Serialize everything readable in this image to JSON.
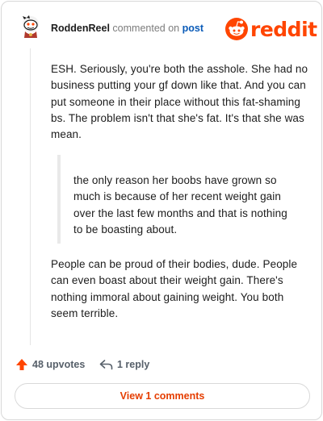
{
  "comment": {
    "username": "RoddenReel",
    "commented_text": "commented on",
    "post_link": "post",
    "avatar_icon": "snoo-avatar-icon",
    "paragraphs": [
      "ESH. Seriously, you're both the asshole. She had no business putting your gf down like that. And you can put someone in their place without this fat-shaming bs. The problem isn't that she's fat. It's that she was mean.",
      "People can be proud of their bodies, dude. People can even boast about their weight gain. There's nothing immoral about gaining weight. You both seem terrible."
    ],
    "quote": "the only reason her boobs have grown so much is because of her recent weight gain over the last few months and that is nothing to be boasting about."
  },
  "brand": {
    "name": "reddit",
    "icon": "reddit-snoo-icon",
    "color": "#ff4500"
  },
  "actions": {
    "upvotes_label": "48 upvotes",
    "upvote_icon": "upvote-arrow-icon",
    "upvote_color": "#ff4500",
    "reply_label": "1 reply",
    "reply_icon": "reply-arrow-icon"
  },
  "footer": {
    "view_comments_label": "View 1 comments",
    "accent": "#e53d00"
  }
}
